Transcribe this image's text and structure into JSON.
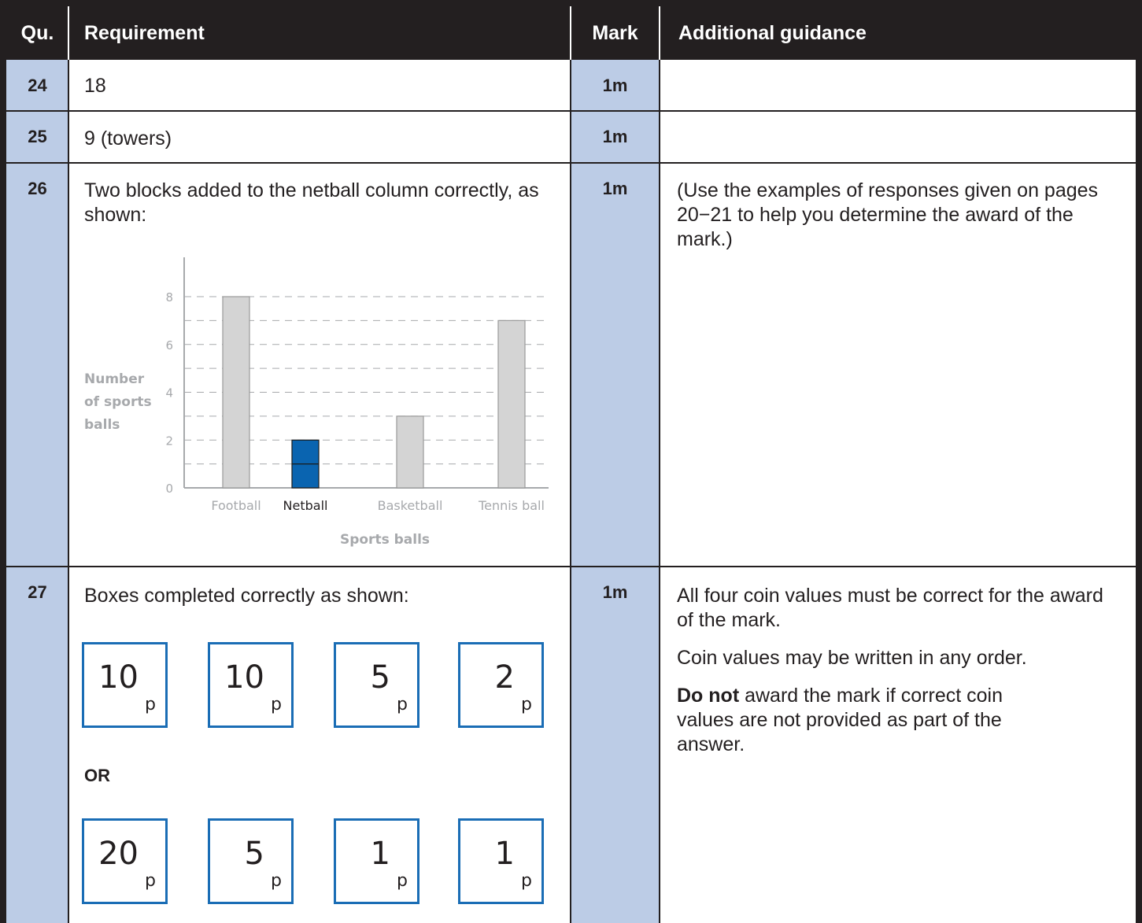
{
  "header": {
    "qu": "Qu.",
    "requirement": "Requirement",
    "mark": "Mark",
    "guidance": "Additional guidance"
  },
  "rows": [
    {
      "qu": "24",
      "requirement": "18",
      "mark": "1m",
      "guidance": ""
    },
    {
      "qu": "25",
      "requirement": "9 (towers)",
      "mark": "1m",
      "guidance": ""
    },
    {
      "qu": "26",
      "requirement": "Two blocks added to the netball column correctly, as shown:",
      "mark": "1m",
      "guidance": "(Use the examples of responses given on pages 20−21 to help you determine the award of the mark.)"
    },
    {
      "qu": "27",
      "requirement": "Boxes completed correctly as shown:",
      "mark": "1m",
      "or_label": "OR",
      "coins_set_1": [
        "10",
        "10",
        "5",
        "2"
      ],
      "coins_set_2": [
        "20",
        "5",
        "1",
        "1"
      ],
      "coin_unit": "p",
      "guidance_1": "All four coin values must be correct for the award of the mark.",
      "guidance_2": "Coin values may be written in any order.",
      "guidance_3_bold": "Do not",
      "guidance_3_rest": " award the mark if correct coin values are not provided as part of the answer."
    }
  ],
  "chart_data": {
    "type": "bar",
    "categories": [
      "Football",
      "Netball",
      "Basketball",
      "Tennis ball"
    ],
    "values": [
      8,
      2,
      3,
      7
    ],
    "highlight_category": "Netball",
    "highlight_color": "#0a64b0",
    "bar_color": "#d4d4d4",
    "xlabel": "Sports balls",
    "ylabel_lines": [
      "Number",
      "of sports",
      "balls"
    ],
    "ylim": [
      0,
      8
    ],
    "ytick_labels": [
      "0",
      "2",
      "4",
      "6",
      "8"
    ],
    "grid": true
  }
}
